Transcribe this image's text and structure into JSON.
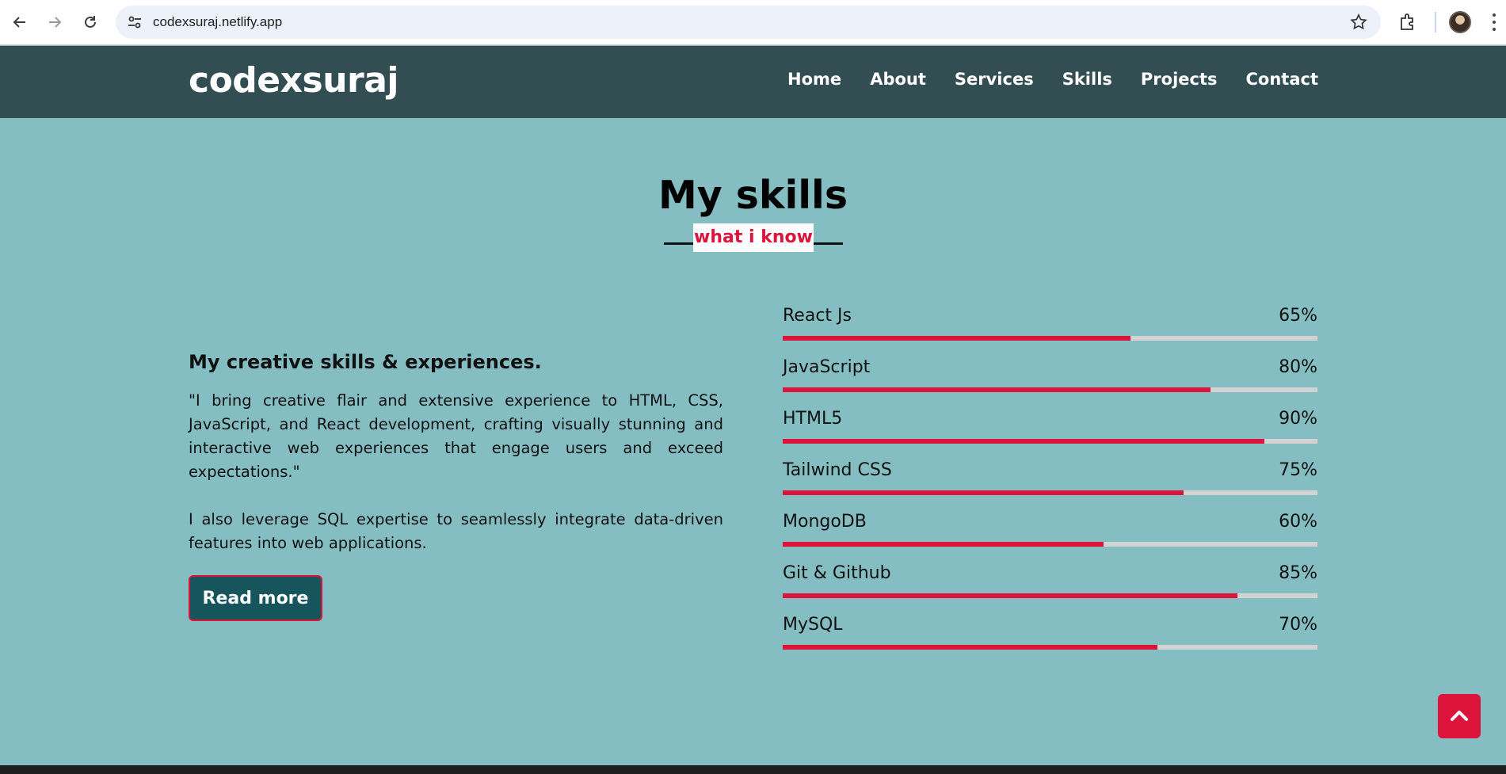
{
  "browser": {
    "url": "codexsuraj.netlify.app"
  },
  "header": {
    "logo": "codexsuraj",
    "nav": [
      "Home",
      "About",
      "Services",
      "Skills",
      "Projects",
      "Contact"
    ]
  },
  "skills_section": {
    "title": "My skills",
    "subtitle": "what i know",
    "heading": "My creative skills & experiences.",
    "paragraph1": "\"I bring creative flair and extensive experience to HTML, CSS, JavaScript, and React development, crafting visually stunning and interactive web experiences that engage users and exceed expectations.\"",
    "paragraph2": "I also leverage SQL expertise to seamlessly integrate data-driven features into web applications.",
    "button_label": "Read more",
    "skills": [
      {
        "name": "React Js",
        "percent_label": "65%",
        "level": 0.65
      },
      {
        "name": "JavaScript",
        "percent_label": "80%",
        "level": 0.8
      },
      {
        "name": "HTML5",
        "percent_label": "90%",
        "level": 0.9
      },
      {
        "name": "Tailwind CSS",
        "percent_label": "75%",
        "level": 0.75
      },
      {
        "name": "MongoDB",
        "percent_label": "60%",
        "level": 0.6
      },
      {
        "name": "Git & Github",
        "percent_label": "85%",
        "level": 0.85
      },
      {
        "name": "MySQL",
        "percent_label": "70%",
        "level": 0.7
      }
    ]
  },
  "colors": {
    "accent": "#dc143c",
    "page_bg": "#85bec2",
    "header_bg": "#334e52",
    "button_bg": "#17555c"
  },
  "icons": {
    "back": "arrow-left-icon",
    "forward": "arrow-right-icon",
    "reload": "reload-icon",
    "site_info": "site-info-icon",
    "bookmark": "star-icon",
    "extensions": "puzzle-icon",
    "scroll_top": "chevron-up-icon"
  }
}
